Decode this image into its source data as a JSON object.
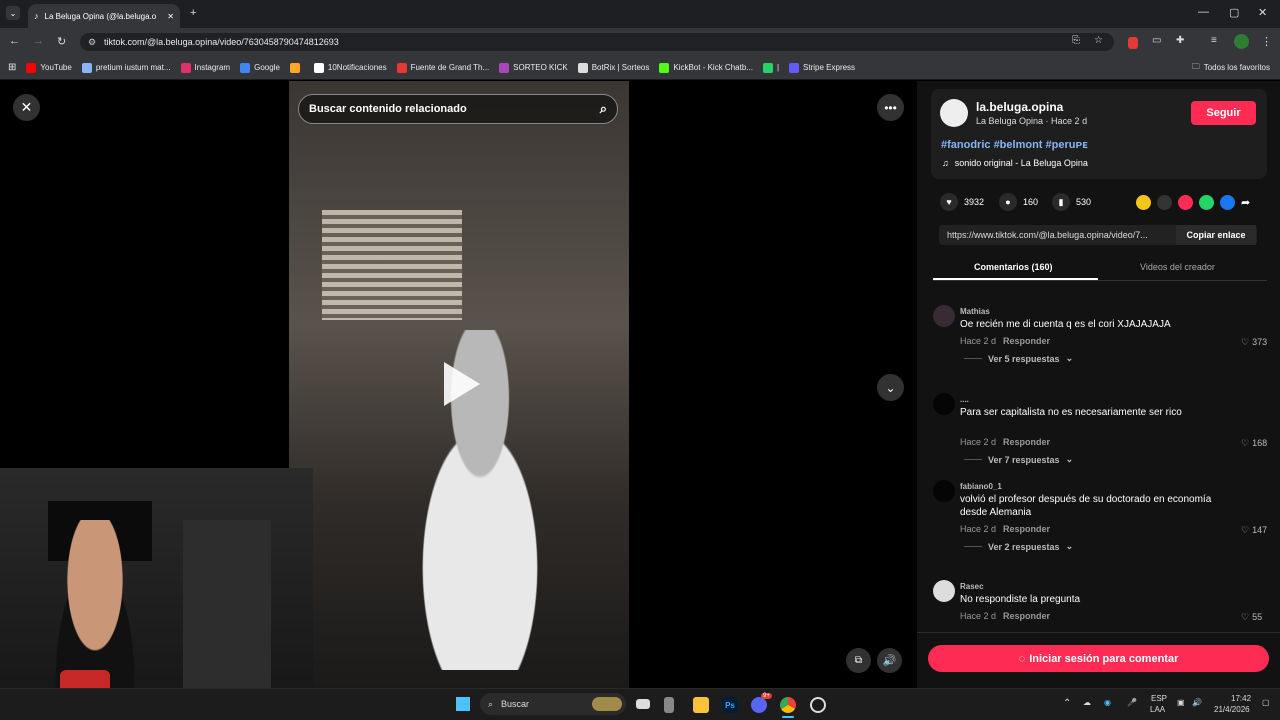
{
  "browser": {
    "tab_title": "La Beluga Opina (@la.beluga.o",
    "url": "tiktok.com/@la.beluga.opina/video/7630458790474812693",
    "bookmarks": [
      {
        "label": "YouTube",
        "color": "#ff0000"
      },
      {
        "label": "pretium iustum mat...",
        "color": "#8ab4f8"
      },
      {
        "label": "Instagram",
        "color": "#e1306c"
      },
      {
        "label": "Google",
        "color": "#4285f4"
      },
      {
        "label": "",
        "color": "#ffa726"
      },
      {
        "label": "10Notificaciones",
        "color": "#ffffff"
      },
      {
        "label": "Fuente de Grand Th...",
        "color": "#e53935"
      },
      {
        "label": "SORTEO KICK",
        "color": "#ab47bc"
      },
      {
        "label": "BotRix | Sorteos",
        "color": "#dddddd"
      },
      {
        "label": "KickBot - Kick Chatb...",
        "color": "#53fc18"
      },
      {
        "label": "|",
        "color": "#25d366"
      },
      {
        "label": "Stripe Express",
        "color": "#635bff"
      }
    ],
    "all_bookmarks": "Todos los favoritos"
  },
  "viewer": {
    "search_placeholder": "Buscar contenido relacionado"
  },
  "creator": {
    "username": "la.beluga.opina",
    "subtitle": "La Beluga Opina · Hace 2 d",
    "follow_label": "Seguir",
    "hashtags": "#fanodric #belmont #peruᴘᴇ",
    "sound": "sonido original - La Beluga Opina"
  },
  "stats": {
    "likes": "3932",
    "comments": "160",
    "saves": "530"
  },
  "share": {
    "link": "https://www.tiktok.com/@la.beluga.opina/video/7...",
    "copy_label": "Copiar enlace",
    "colors": [
      "#f5c518",
      "#333333",
      "#fe2c55",
      "#25d366",
      "#1877f2"
    ]
  },
  "tabs": {
    "comments": "Comentarios (160)",
    "creator_videos": "Videos del creador"
  },
  "comments": [
    {
      "user": "Mathias",
      "text": "Oe recién me di cuenta q es el cori XJAJAJAJA",
      "time": "Hace 2 d",
      "reply": "Responder",
      "likes": "373",
      "replies": "Ver 5 respuestas",
      "avatar": "#3a2a35"
    },
    {
      "user": "....",
      "text": "Para ser capitalista no es necesariamente ser rico",
      "time": "Hace 2 d",
      "reply": "Responder",
      "likes": "168",
      "replies": "Ver 7 respuestas",
      "avatar": "#050505"
    },
    {
      "user": "fabiano0_1",
      "text": "volvió el profesor después de su doctorado en economía desde Alemania",
      "time": "Hace 2 d",
      "reply": "Responder",
      "likes": "147",
      "replies": "Ver 2 respuestas",
      "avatar": "#050505"
    },
    {
      "user": "Rasec",
      "text": "No respondiste la pregunta",
      "time": "Hace 2 d",
      "reply": "Responder",
      "likes": "55",
      "replies": "",
      "avatar": "#dddddd"
    }
  ],
  "login_label": "Iniciar sesión para comentar",
  "taskbar": {
    "search_label": "Buscar",
    "lang": "ESP",
    "layout": "LAA",
    "time": "17:42",
    "date": "21/4/2026",
    "discord_badge": "9+"
  }
}
